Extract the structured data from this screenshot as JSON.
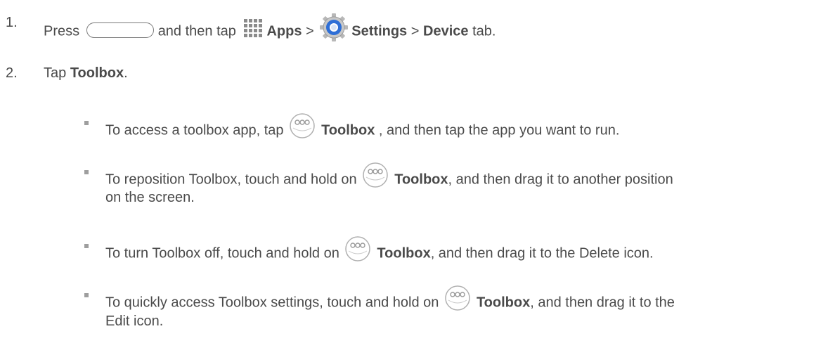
{
  "step1": {
    "num": "1.",
    "press": "Press",
    "then_tap": "and then tap",
    "apps": "Apps",
    "gt1": ">",
    "settings": "Settings",
    "gt2": ">",
    "device": "Device",
    "tab": "tab."
  },
  "step2": {
    "num": "2.",
    "tap": "Tap",
    "toolbox": "Toolbox",
    "period": "."
  },
  "bullets": [
    {
      "before": "To access a toolbox app, tap",
      "bold": "Toolbox",
      "after": ", and then tap the app you want to run."
    },
    {
      "before": "To reposition Toolbox, touch and hold on",
      "bold": "Toolbox",
      "after": ", and then drag it to another position",
      "line2": "on the screen."
    },
    {
      "before": "To turn Toolbox off, touch and hold on",
      "bold": "Toolbox",
      "after": ", and then drag it to the Delete icon."
    },
    {
      "before": "To quickly access Toolbox settings, touch and hold on",
      "bold": "Toolbox",
      "after": ", and then drag it to the",
      "line2": "Edit icon."
    }
  ],
  "colors": {
    "text": "#4a4a4a",
    "settings_blue": "#2f6fd6",
    "icon_gray": "#8a8a8a"
  },
  "icons": [
    "home-key-icon",
    "apps-grid-icon",
    "settings-gear-icon",
    "toolbox-icon"
  ]
}
